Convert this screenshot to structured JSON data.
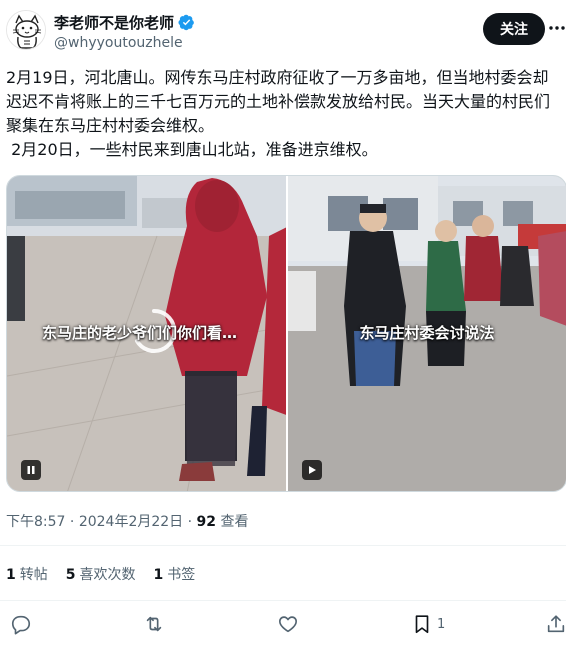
{
  "author": {
    "display_name": "李老师不是你老师",
    "handle": "@whyyoutouzhele",
    "verified": true,
    "avatar_icon": "cat-sketch-avatar"
  },
  "follow_label": "关注",
  "tweet_text": "2月19日，河北唐山。网传东马庄村政府征收了一万多亩地，但当地村委会却迟迟不肯将账上的三千七百万元的土地补偿款发放给村民。当天大量的村民们聚集在东马庄村村委会维权。\n 2月20日，一些村民来到唐山北站，准备进京维权。",
  "media": {
    "left_caption": "东马庄的老少爷们们你们看…",
    "right_caption": "东马庄村委会讨说法",
    "left_control": "pause-icon",
    "right_control": "play-icon"
  },
  "meta": {
    "time": "下午8:57",
    "date": "2024年2月22日",
    "separator": "·",
    "views_count": "92",
    "views_label": "查看"
  },
  "stats": {
    "retweets_count": "1",
    "retweets_label": "转帖",
    "likes_count": "5",
    "likes_label": "喜欢次数",
    "bookmarks_count": "1",
    "bookmarks_label": "书签"
  },
  "actions": {
    "bookmark_count": "1"
  },
  "colors": {
    "accent_blue": "#1d9bf0",
    "text_primary": "#0f1419",
    "text_secondary": "#536471",
    "follow_bg": "#0f1419"
  }
}
